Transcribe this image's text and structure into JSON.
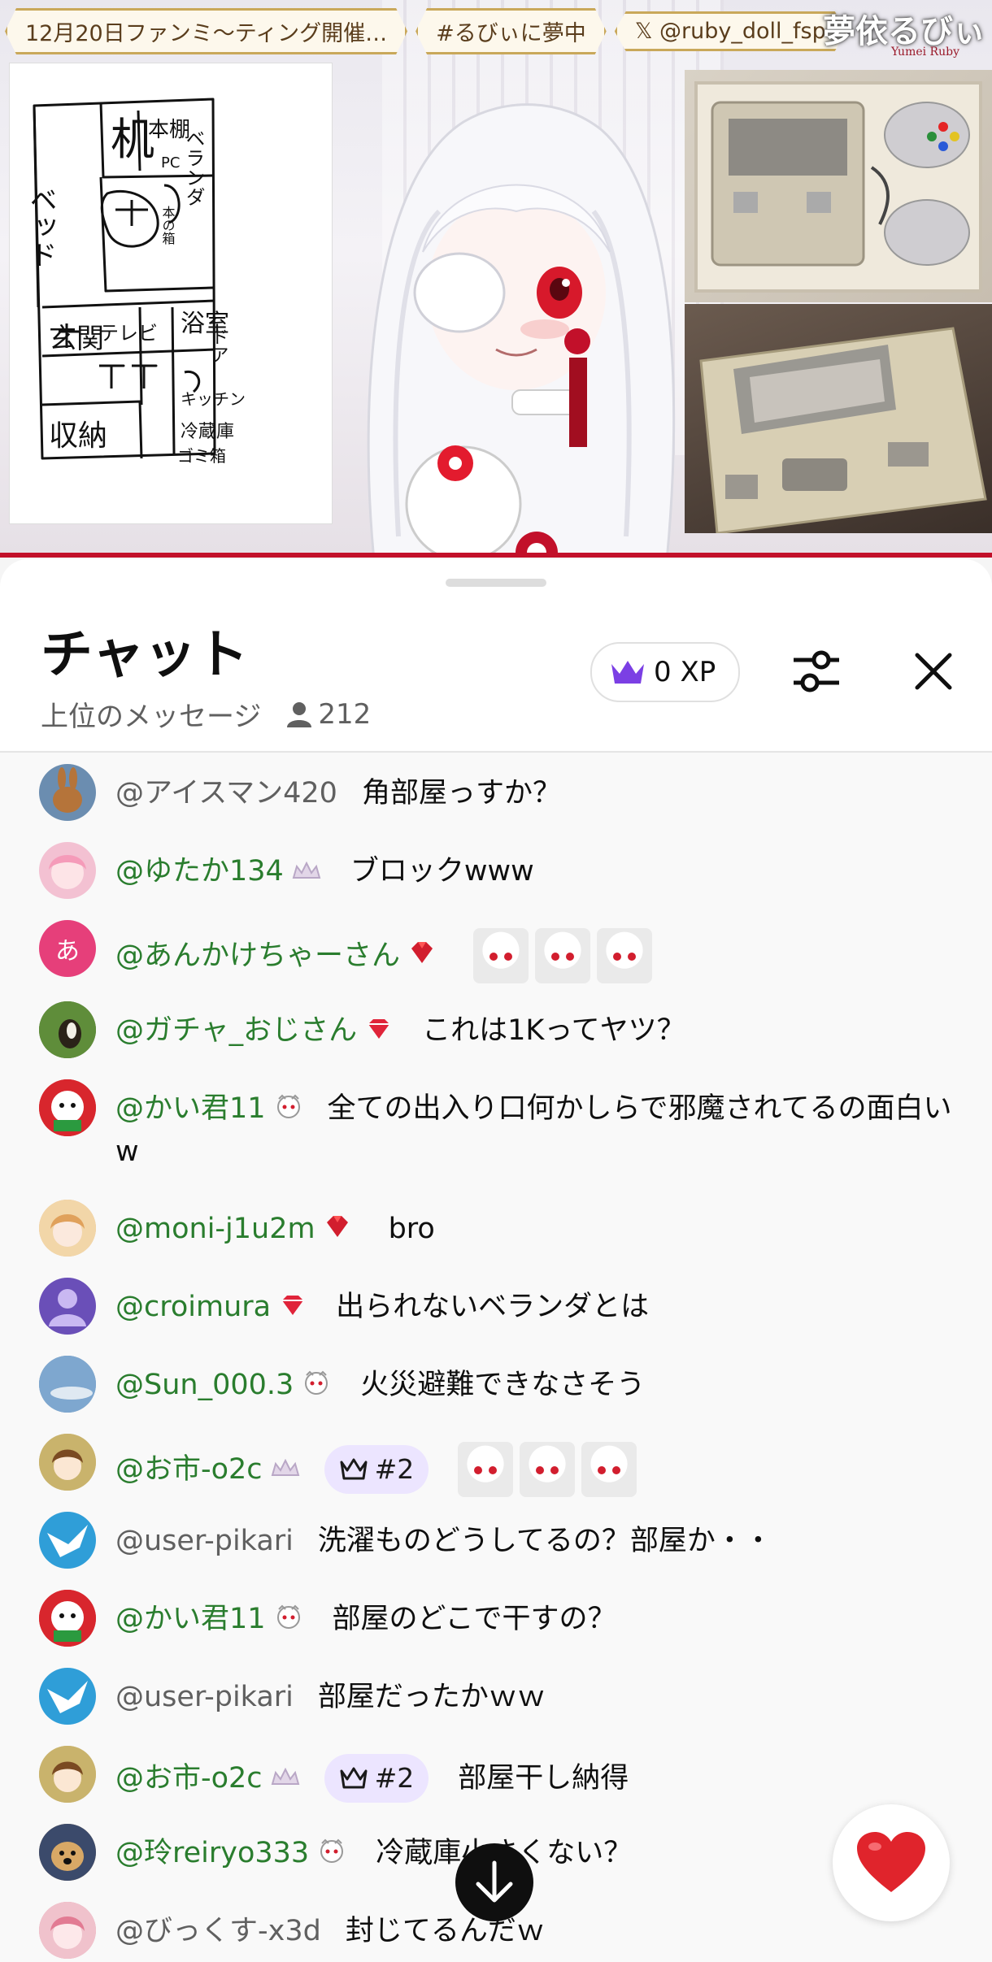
{
  "stream": {
    "banner": {
      "event": "12月20日ファンミ〜ティング開催…",
      "hashtag": "#るびぃに夢中",
      "handle": "𝕏 @ruby_doll_fsp"
    },
    "logo": "夢依るびぃ",
    "logo_sub": "Yumei Ruby",
    "drawing": {
      "labels": [
        "ベッド",
        "机",
        "本棚",
        "ベランダ",
        "PC",
        "本の箱",
        "ドア",
        "浴室",
        "キッチン",
        "冷蔵庫",
        "玄関",
        "テレビ",
        "収納",
        "ゴミ箱"
      ]
    }
  },
  "chat": {
    "title": "チャット",
    "filter_label": "上位のメッセージ",
    "viewer_count": "212",
    "xp_label": "0 XP"
  },
  "messages": [
    {
      "author": "@アイスマン420",
      "member": false,
      "text": "角部屋っすか？",
      "avatar_color": "#6b8db0"
    },
    {
      "author": "@ゆたか134",
      "member": true,
      "badge": "crown",
      "text": "ブロックwww",
      "avatar_color": "#f3c1d2"
    },
    {
      "author": "@あんかけちゃーさん",
      "member": true,
      "badge": "ruby",
      "text": "",
      "emotes": 3,
      "avatar_letter": "あ",
      "avatar_color": "#e63f7a"
    },
    {
      "author": "@ガチャ_おじさん",
      "member": true,
      "badge": "gem",
      "text": "これは1Kってヤツ？",
      "avatar_color": "#4a6a2e"
    },
    {
      "author": "@かい君11",
      "member": true,
      "badge": "mascot",
      "text": "全ての出入り口何かしらで邪魔されてるの面白いw",
      "avatar_color": "#2ea44f"
    },
    {
      "author": "@moni-j1u2m",
      "member": true,
      "badge": "ruby",
      "text": "bro",
      "avatar_color": "#e8b987"
    },
    {
      "author": "@croimura",
      "member": true,
      "badge": "gem",
      "text": "出られないベランダとは",
      "avatar_color": "#6a4fb8"
    },
    {
      "author": "@Sun_000.3",
      "member": true,
      "badge": "mascot",
      "text": "火災避難できなさそう",
      "avatar_color": "#6f93b9"
    },
    {
      "author": "@お市-o2c",
      "member": true,
      "badge": "crown",
      "rank": "#2",
      "text": "",
      "emotes": 3,
      "avatar_color": "#d8c28a"
    },
    {
      "author": "@user-pikari",
      "member": false,
      "text": "洗濯ものどうしてるの？部屋か・・",
      "avatar_color": "#2f9ed8"
    },
    {
      "author": "@かい君11",
      "member": true,
      "badge": "mascot",
      "text": "部屋のどこで干すの？",
      "avatar_color": "#2ea44f"
    },
    {
      "author": "@user-pikari",
      "member": false,
      "text": "部屋だったかｗｗ",
      "avatar_color": "#2f9ed8"
    },
    {
      "author": "@お市-o2c",
      "member": true,
      "badge": "crown",
      "rank": "#2",
      "text": "部屋干し納得",
      "avatar_color": "#d8c28a"
    },
    {
      "author": "@玲reiryo333",
      "member": true,
      "badge": "mascot",
      "text": "冷蔵庫小さくない？",
      "avatar_color": "#c89a5e"
    },
    {
      "author": "@びっくす-x3d",
      "member": false,
      "text": "封じてるんだｗ",
      "avatar_color": "#e59aa8"
    }
  ],
  "colors": {
    "member_green": "#2a7d2e",
    "muted": "#606060",
    "rank_bg": "#ece5ff",
    "accent_purple": "#7b3fe4",
    "heart": "#e0242c"
  }
}
